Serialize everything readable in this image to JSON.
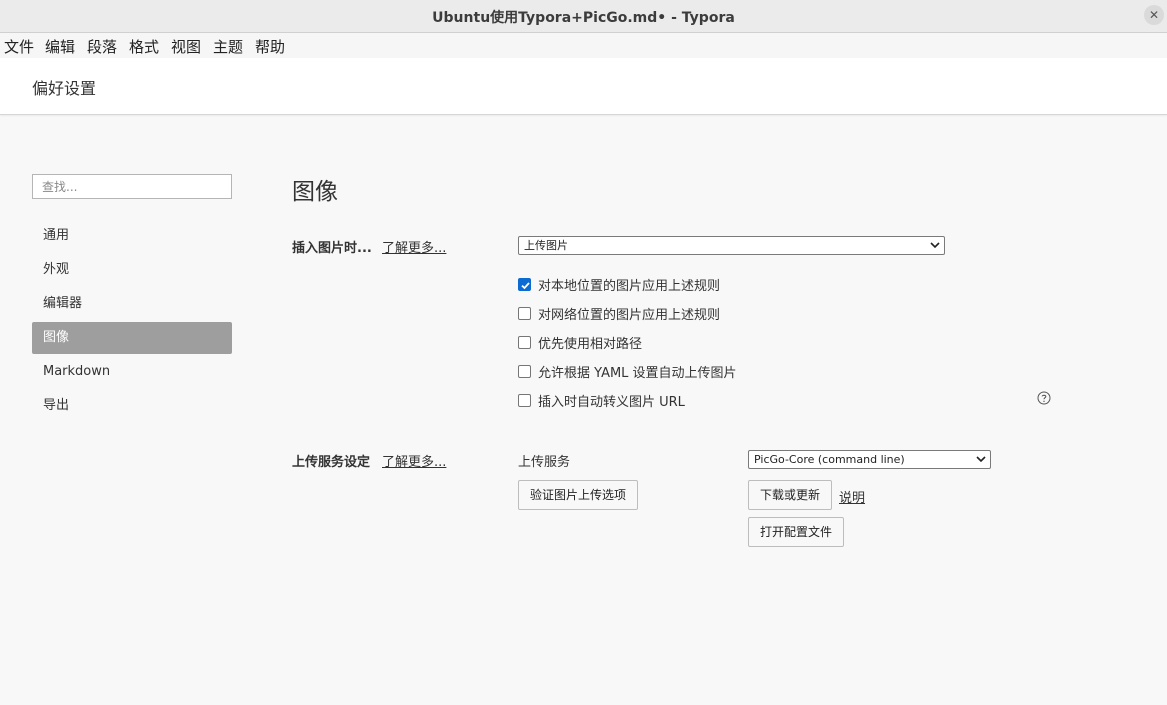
{
  "window": {
    "title": "Ubuntu使用Typora+PicGo.md• - Typora",
    "close_glyph": "✕"
  },
  "menubar": {
    "items": [
      "文件",
      "编辑",
      "段落",
      "格式",
      "视图",
      "主题",
      "帮助"
    ]
  },
  "header": {
    "title": "偏好设置"
  },
  "sidebar": {
    "search_placeholder": "查找...",
    "items": [
      {
        "label": "通用"
      },
      {
        "label": "外观"
      },
      {
        "label": "编辑器"
      },
      {
        "label": "图像"
      },
      {
        "label": "Markdown"
      },
      {
        "label": "导出"
      }
    ],
    "active_index": 3
  },
  "main": {
    "section_title": "图像",
    "insert": {
      "label": "插入图片时...",
      "learn_more": "了解更多...",
      "select_value": "上传图片",
      "options": [
        {
          "label": "对本地位置的图片应用上述规则",
          "checked": true
        },
        {
          "label": "对网络位置的图片应用上述规则",
          "checked": false
        },
        {
          "label": "优先使用相对路径",
          "checked": false
        },
        {
          "label": "允许根据 YAML 设置自动上传图片",
          "checked": false
        },
        {
          "label": "插入时自动转义图片 URL",
          "checked": false
        }
      ]
    },
    "upload": {
      "label": "上传服务设定",
      "learn_more": "了解更多...",
      "service_label": "上传服务",
      "service_value": "PicGo-Core (command line)",
      "verify_button": "验证图片上传选项",
      "download_button": "下载或更新",
      "explain_link": "说明",
      "open_config_button": "打开配置文件"
    }
  },
  "colors": {
    "accent": "#0b6bd3",
    "active_nav": "#9e9e9e"
  }
}
